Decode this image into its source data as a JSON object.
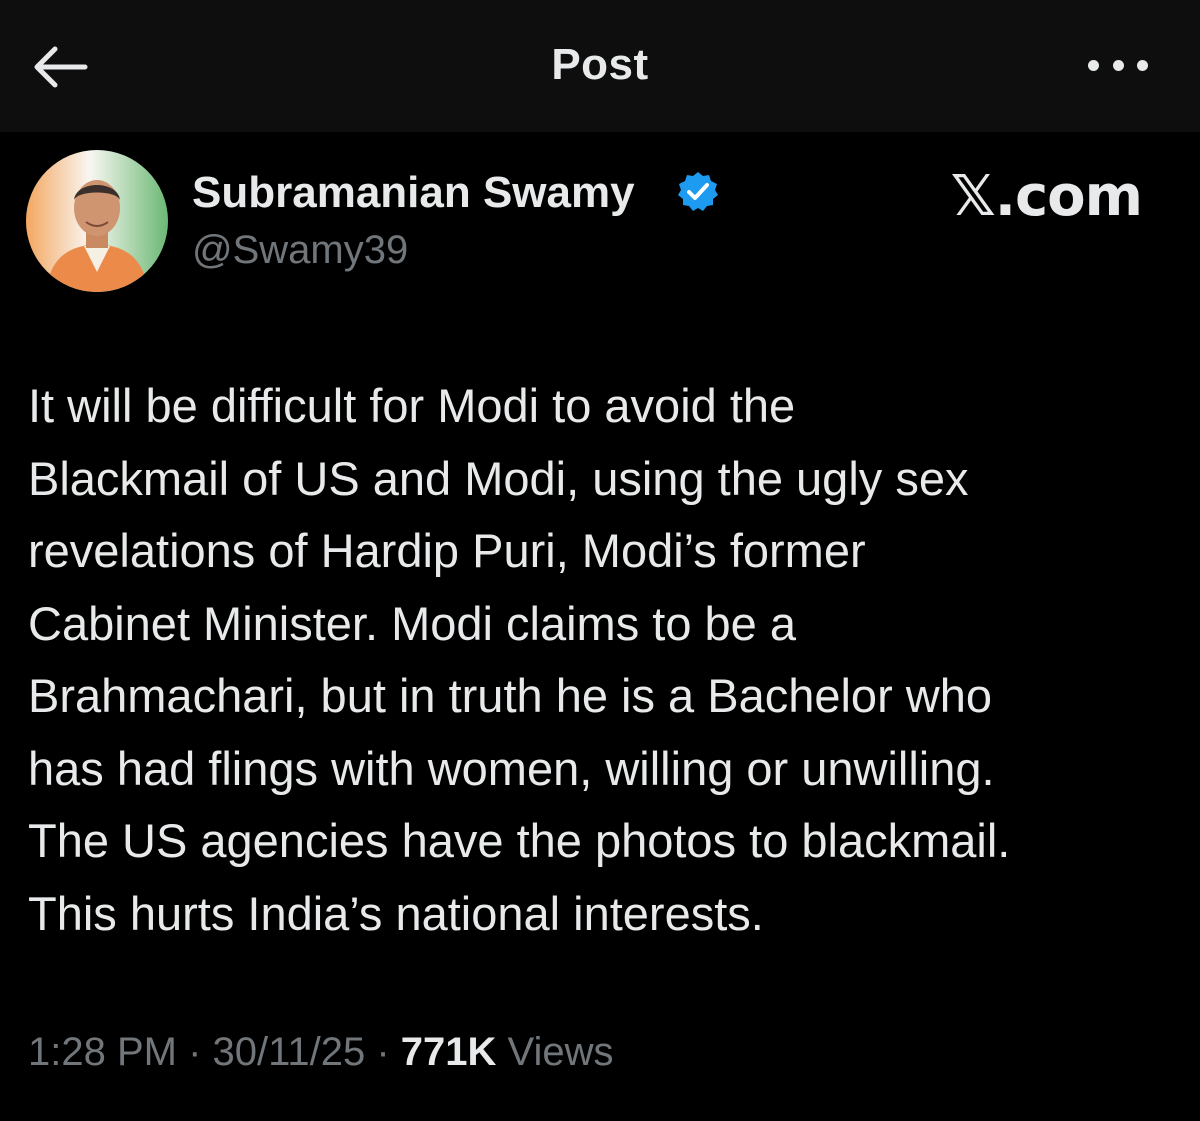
{
  "header": {
    "title": "Post",
    "back_icon": "arrow-left-icon",
    "more_icon": "more-horizontal-icon"
  },
  "author": {
    "name": "Subramanian Swamy",
    "handle": "@Swamy39",
    "verified": true,
    "verified_color": "#1d9bf0"
  },
  "watermark": "𝕏.com",
  "post": {
    "lines": [
      "It will be difficult for Modi to avoid the",
      "Blackmail of US and Modi, using the ugly sex",
      "revelations of Hardip Puri, Modi’s former",
      "Cabinet Minister. Modi claims to be a",
      "Brahmachari, but in truth he is a Bachelor who",
      "has had flings with women, willing or unwilling.",
      "The US agencies have the photos to blackmail.",
      "This hurts India’s national interests."
    ]
  },
  "meta": {
    "time": "1:28 PM",
    "sep1": " · ",
    "date": "30/11/25",
    "sep2": " · ",
    "views_count": "771K",
    "views_label": " Views"
  },
  "colors": {
    "background": "#000000",
    "header_bg": "#0e0e0e",
    "text_primary": "#e7e9ea",
    "text_secondary": "#71767b"
  }
}
